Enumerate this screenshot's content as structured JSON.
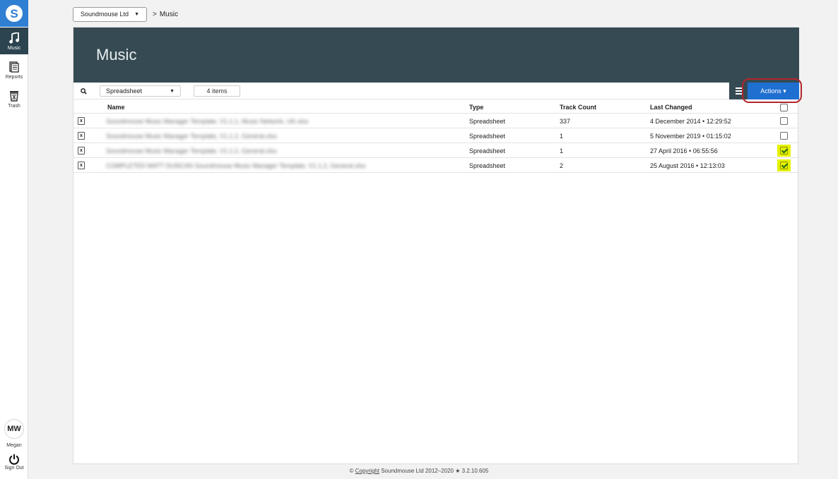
{
  "sidebar": {
    "logo_letter": "S",
    "items": [
      {
        "label": "Music",
        "icon": "music-note-icon"
      },
      {
        "label": "Reports",
        "icon": "report-icon"
      },
      {
        "label": "Trash",
        "icon": "trash-icon"
      }
    ],
    "user": {
      "initials": "MW",
      "name": "Megan"
    },
    "signout_label": "Sign Out"
  },
  "breadcrumb": {
    "org": "Soundmouse Ltd",
    "separator": ">",
    "current": "Music"
  },
  "page": {
    "title": "Music"
  },
  "toolbar": {
    "type_filter": "Spreadsheet",
    "item_count": "4 items",
    "actions_label": "Actions ▾"
  },
  "table": {
    "columns": [
      "Name",
      "Type",
      "Track Count",
      "Last Changed"
    ],
    "rows": [
      {
        "name": "Soundmouse Music Manager Template, V1.1.1, Music Network, UK.xlsx",
        "type": "Spreadsheet",
        "track_count": "337",
        "last_changed": "4 December 2014 • 12:29:52",
        "checked": false
      },
      {
        "name": "Soundmouse Music Manager Template, V1.1.2, General.xlsx",
        "type": "Spreadsheet",
        "track_count": "1",
        "last_changed": "5 November 2019 • 01:15:02",
        "checked": false
      },
      {
        "name": "Soundmouse Music Manager Template, V1.1.2, General.xlsx",
        "type": "Spreadsheet",
        "track_count": "1",
        "last_changed": "27 April 2016 • 06:55:56",
        "checked": true
      },
      {
        "name": "COMPLETED MATT DUNCAN Soundmouse Music Manager Template, V1.1.2, General.xlsx",
        "type": "Spreadsheet",
        "track_count": "2",
        "last_changed": "25 August 2016 • 12:13:03",
        "checked": true
      }
    ]
  },
  "footer": {
    "prefix": "©",
    "link": "Copyright",
    "text": "Soundmouse Ltd 2012–2020 ★ 3.2.10.605"
  },
  "colors": {
    "brand_blue": "#2f7fd3",
    "hero_dark": "#364a53",
    "actions_blue": "#1f6fd1",
    "highlight_yellow": "#e6f200",
    "annotation_red": "#b3262d"
  }
}
